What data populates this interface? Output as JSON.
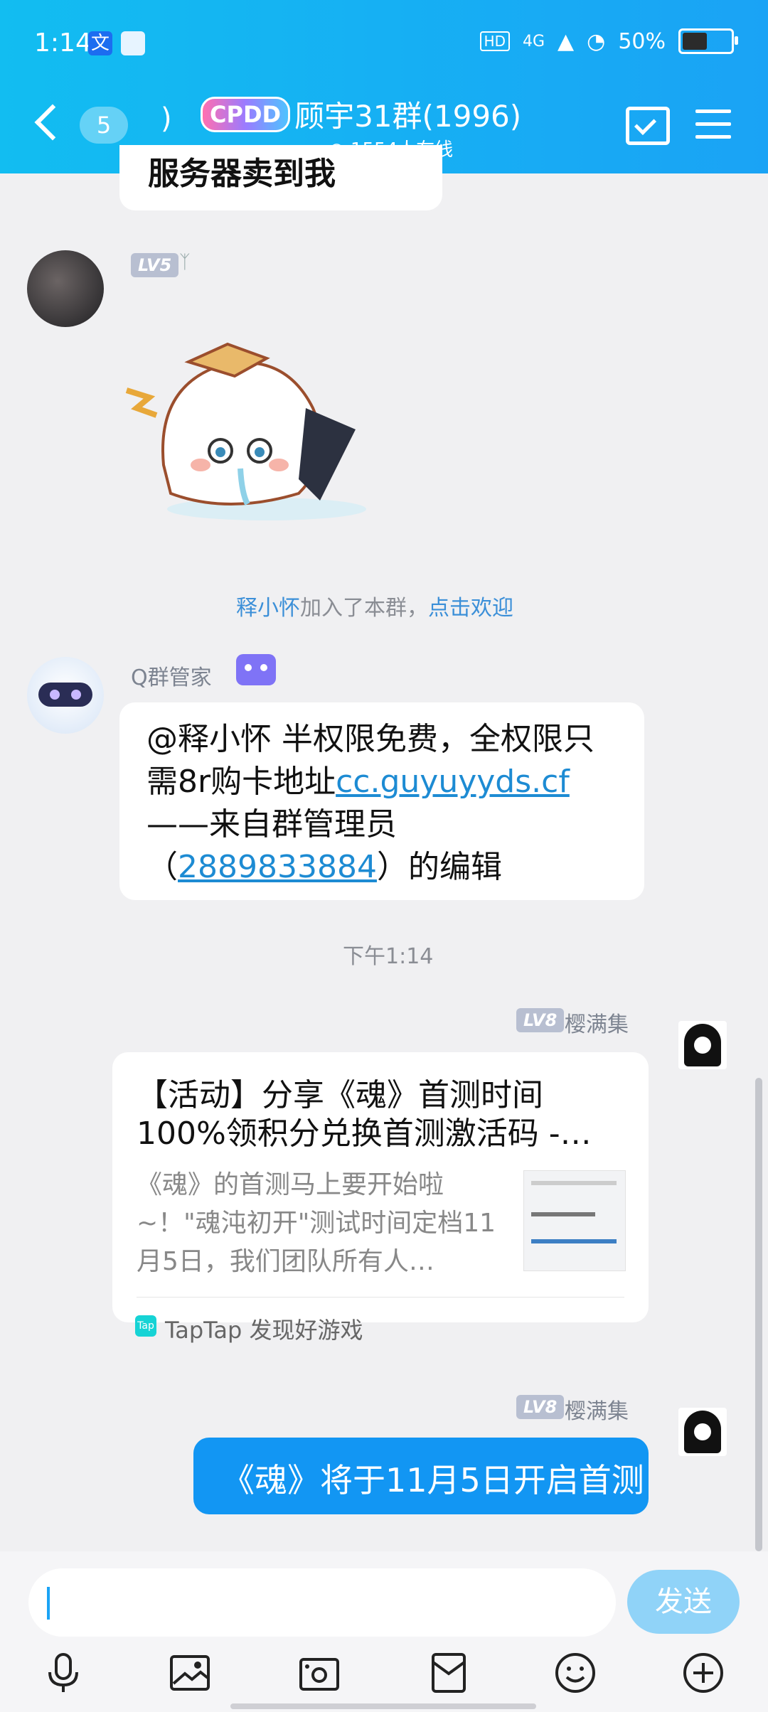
{
  "status_bar": {
    "time": "1:14",
    "network": "HD",
    "signal": "4G",
    "battery": "50%"
  },
  "header": {
    "unread_count": "5",
    "tag": "CPDD",
    "title": "顾宇31群(1996)",
    "online": "1554人在线"
  },
  "messages": {
    "top_partial": "服务器卖到我",
    "m1_level": "LV5",
    "system_join_name": "释小怀",
    "system_join_text": "加入了本群，",
    "system_join_action": "点击欢迎",
    "bot_name": "Q群管家",
    "bot_line1": "@释小怀 半权限免费，全权限只",
    "bot_line2_pre": "需8r购卡地址",
    "bot_link": "cc.guyuyyds.cf",
    "bot_line3": "——来自群管理员",
    "bot_line4_pre": "（",
    "bot_qq": "2889833884",
    "bot_line4_post": "）的编辑",
    "timestamp": "下午1:14",
    "user2_level": "LV8",
    "user2_name": "樱满集",
    "card_title": "【活动】分享《魂》首测时间100%领积分兑换首测激活码 -…",
    "card_desc": "《魂》的首测马上要开始啦~！\"魂沌初开\"测试时间定档11月5日，我们团队所有人…",
    "card_source": "TapTap 发现好游戏",
    "user3_level": "LV8",
    "user3_name": "樱满集",
    "blue_msg": "《魂》将于11月5日开启首测"
  },
  "composer": {
    "send_label": "发送"
  }
}
